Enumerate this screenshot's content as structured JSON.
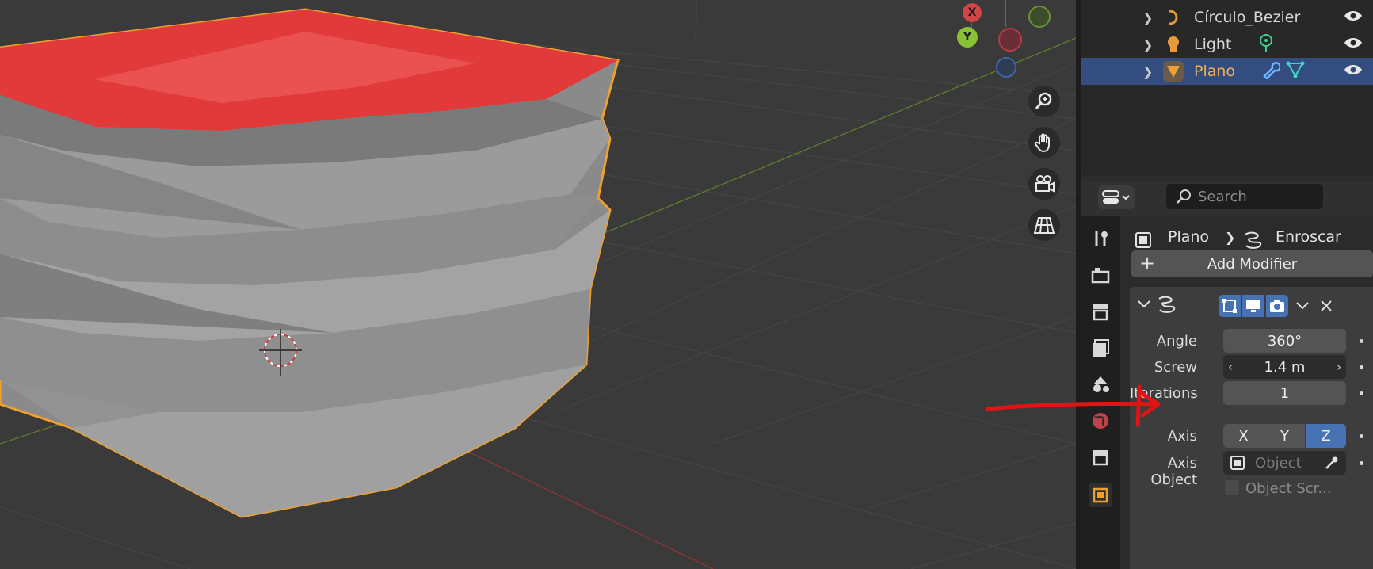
{
  "colors": {
    "accent": "#4772b3",
    "selected_face": "#e23a3a",
    "outline": "#f0a030",
    "annotation_arrow": "#e01414"
  },
  "gizmo": {
    "x_label": "X",
    "y_label": "Y"
  },
  "outliner": {
    "items": [
      {
        "label": "Círculo_Bezier",
        "icon": "curve-icon",
        "selected": false
      },
      {
        "label": "Light",
        "icon": "light-icon",
        "selected": false
      },
      {
        "label": "Plano",
        "icon": "mesh-icon",
        "selected": true
      }
    ]
  },
  "properties": {
    "search_placeholder": "Search",
    "breadcrumb": {
      "object": "Plano",
      "modifier": "Enroscar"
    },
    "add_modifier_label": "Add Modifier",
    "modifier": {
      "angle_label": "Angle",
      "angle_value": "360°",
      "screw_label": "Screw",
      "screw_value": "1.4 m",
      "iterations_label": "Iterations",
      "iterations_value": "1",
      "axis_label": "Axis",
      "axis_options": [
        "X",
        "Y",
        "Z"
      ],
      "axis_selected": "Z",
      "axis_object_label": "Axis Object",
      "axis_object_placeholder": "Object",
      "object_screw_label": "Object Scr..."
    }
  }
}
